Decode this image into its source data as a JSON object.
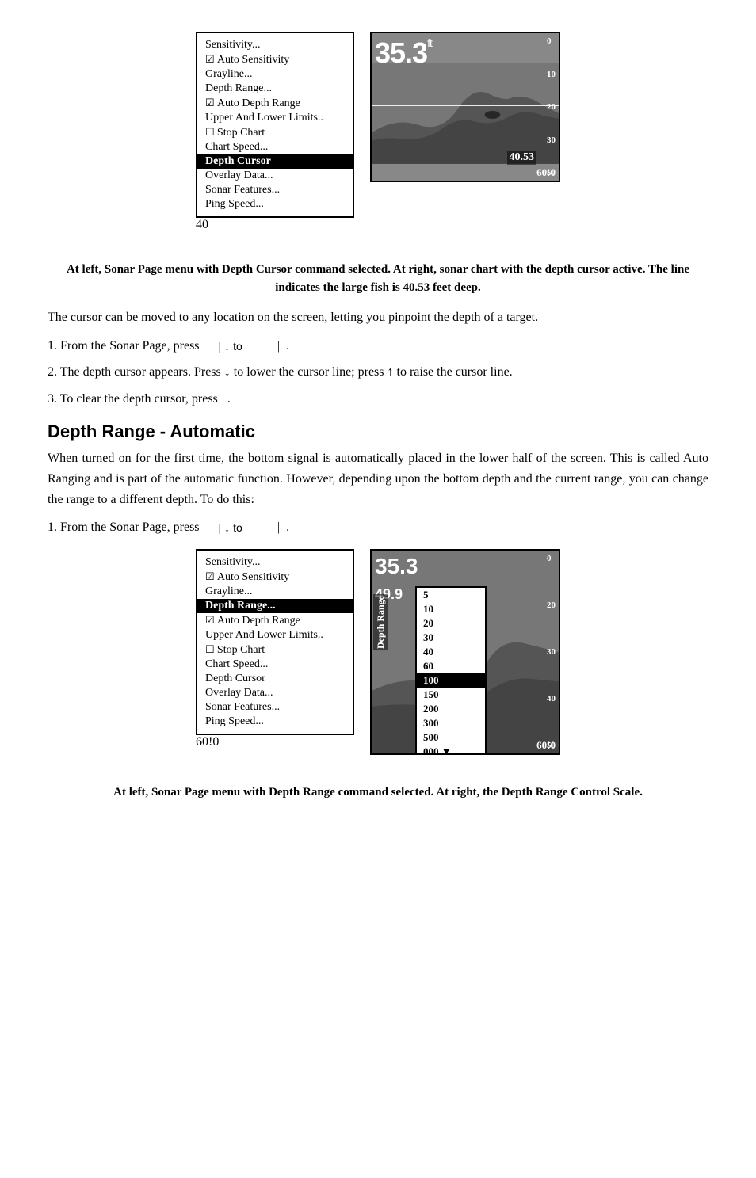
{
  "figures": {
    "top": {
      "menu": {
        "items": [
          {
            "label": "Sensitivity...",
            "type": "normal"
          },
          {
            "label": "Auto Sensitivity",
            "type": "checkbox"
          },
          {
            "label": "Grayline...",
            "type": "normal"
          },
          {
            "label": "Depth Range...",
            "type": "normal"
          },
          {
            "label": "Auto Depth Range",
            "type": "checkbox"
          },
          {
            "label": "Upper And Lower Limits..",
            "type": "normal"
          },
          {
            "label": "Stop Chart",
            "type": "checkbox-unchecked"
          },
          {
            "label": "Chart Speed...",
            "type": "normal"
          },
          {
            "label": "Depth Cursor",
            "type": "highlighted"
          },
          {
            "label": "Overlay Data...",
            "type": "normal"
          },
          {
            "label": "Sonar Features...",
            "type": "normal"
          },
          {
            "label": "Ping Speed...",
            "type": "normal"
          }
        ],
        "footer": "40"
      },
      "sonar": {
        "depth": "35.3",
        "ft": "ft",
        "scale": [
          "0",
          "10",
          "20",
          "30",
          "50",
          "60!0"
        ],
        "bottom_value": "40.53",
        "footer_left": "",
        "footer_right": "60!0"
      }
    },
    "caption_top": "At left, Sonar Page menu with Depth Cursor command selected. At right, sonar chart with the depth cursor active. The line indicates the large fish is 40.53 feet deep.",
    "bottom": {
      "menu": {
        "items": [
          {
            "label": "Sensitivity...",
            "type": "normal"
          },
          {
            "label": "Auto Sensitivity",
            "type": "checkbox"
          },
          {
            "label": "Grayline...",
            "type": "normal"
          },
          {
            "label": "Depth Range...",
            "type": "highlighted"
          },
          {
            "label": "Auto Depth Range",
            "type": "checkbox"
          },
          {
            "label": "Upper And Lower Limits..",
            "type": "normal"
          },
          {
            "label": "Stop Chart",
            "type": "checkbox-unchecked"
          },
          {
            "label": "Chart Speed...",
            "type": "normal"
          },
          {
            "label": "Depth Cursor",
            "type": "normal"
          },
          {
            "label": "Overlay Data...",
            "type": "normal"
          },
          {
            "label": "Sonar Features...",
            "type": "normal"
          },
          {
            "label": "Ping Speed...",
            "type": "normal"
          }
        ],
        "footer": "60!0"
      },
      "sonar": {
        "depth": "35.3",
        "submain": "49.9",
        "range_items": [
          "5",
          "10",
          "20",
          "30",
          "40",
          "60",
          "100",
          "150",
          "200",
          "300",
          "500",
          "000"
        ],
        "selected_range": "100",
        "scale": [
          "0",
          "20",
          "30",
          "40",
          "50",
          "60!0"
        ],
        "footer_right": "60!0"
      }
    },
    "caption_bottom": "At left, Sonar Page menu with Depth Range command selected. At right, the Depth Range Control Scale."
  },
  "body": {
    "para1": "The cursor can be moved to any location on the screen, letting you pinpoint the depth of a target.",
    "step1": "1. From the Sonar Page, press",
    "step1_keys": "| ↓ to",
    "step1_end": "|  .",
    "step2": "2. The depth cursor appears. Press ↓ to lower the cursor line; press ↑ to raise the cursor line.",
    "step3": "3. To clear the depth cursor, press  .",
    "section_heading": "Depth Range - Automatic",
    "section_para": "When turned on for the first time, the bottom signal is automatically placed in the lower half of the screen. This is called Auto Ranging and is part of the automatic function. However, depending upon the bottom depth and the current range, you can change the range to a different depth. To do this:",
    "bottom_step1": "1. From the Sonar Page, press",
    "bottom_step1_keys": "| ↓ to",
    "bottom_step1_end": "|  ."
  }
}
